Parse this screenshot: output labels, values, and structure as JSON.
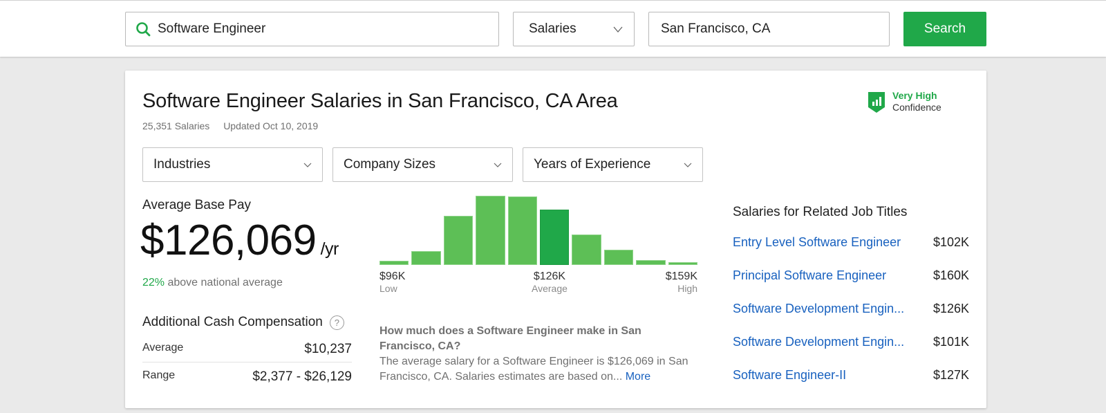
{
  "search": {
    "keyword": "Software Engineer",
    "type_selected": "Salaries",
    "location": "San Francisco, CA",
    "button_label": "Search"
  },
  "header": {
    "title": "Software Engineer Salaries in San Francisco, CA Area",
    "salary_count": "25,351 Salaries",
    "updated": "Updated Oct 10, 2019",
    "confidence_level": "Very High",
    "confidence_label": "Confidence"
  },
  "filters": [
    {
      "label": "Industries"
    },
    {
      "label": "Company Sizes"
    },
    {
      "label": "Years of Experience"
    }
  ],
  "base_pay": {
    "label": "Average Base Pay",
    "value": "$126,069",
    "unit": "/yr",
    "percent": "22%",
    "comparison": "above national average"
  },
  "additional_cash": {
    "title": "Additional Cash Compensation",
    "help": "?",
    "rows": [
      {
        "label": "Average",
        "value": "$10,237"
      },
      {
        "label": "Range",
        "value": "$2,377 - $26,129"
      }
    ]
  },
  "chart_data": {
    "type": "bar",
    "title": "",
    "xlabel": "",
    "ylabel": "",
    "categories": [
      "1",
      "2",
      "3",
      "4",
      "5",
      "6",
      "7",
      "8",
      "9",
      "10"
    ],
    "values": [
      6,
      20,
      70,
      98,
      97,
      78,
      43,
      22,
      7,
      4
    ],
    "highlight_index": 5,
    "ylim": [
      0,
      100
    ],
    "grid": false,
    "labels": {
      "low_value": "$96K",
      "low_label": "Low",
      "avg_value": "$126K",
      "avg_label": "Average",
      "high_value": "$159K",
      "high_label": "High"
    },
    "colors": {
      "bar": "#5dbf56",
      "highlight": "#20a849"
    }
  },
  "faq": {
    "question": "How much does a Software Engineer make in San Francisco, CA?",
    "answer": "The average salary for a Software Engineer is $126,069 in San Francisco, CA. Salaries estimates are based on...",
    "more": "More"
  },
  "related": {
    "title": "Salaries for Related Job Titles",
    "items": [
      {
        "title": "Entry Level Software Engineer",
        "salary": "$102K"
      },
      {
        "title": "Principal Software Engineer",
        "salary": "$160K"
      },
      {
        "title": "Software Development Engin...",
        "salary": "$126K"
      },
      {
        "title": "Software Development Engin...",
        "salary": "$101K"
      },
      {
        "title": "Software Engineer-II",
        "salary": "$127K"
      }
    ]
  },
  "colors": {
    "brand": "#20a849",
    "link": "#1861bf"
  }
}
